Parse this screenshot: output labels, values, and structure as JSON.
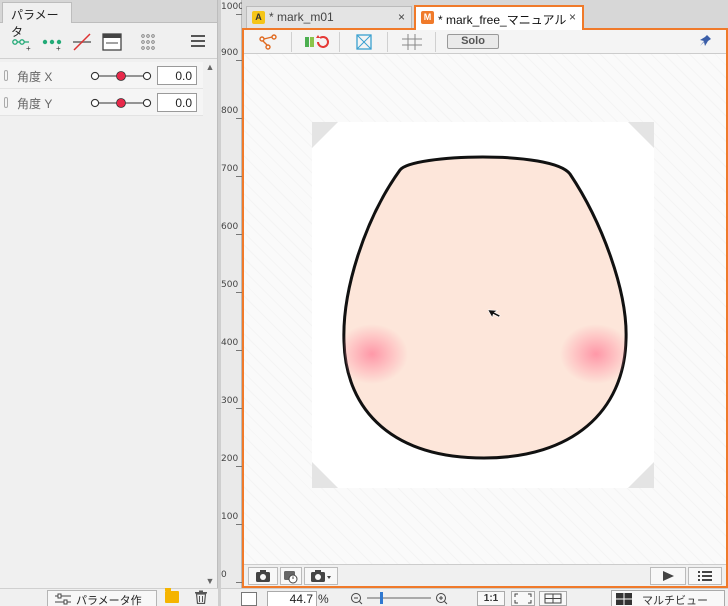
{
  "left_panel": {
    "tab_label": "パラメータ",
    "params": [
      {
        "name": "角度 X",
        "value": "0.0"
      },
      {
        "name": "角度 Y",
        "value": "0.0"
      }
    ],
    "create_button": "パラメータ作成"
  },
  "ruler": {
    "labels": [
      "1000",
      "900",
      "800",
      "700",
      "600",
      "500",
      "400",
      "300",
      "200",
      "100",
      "0"
    ]
  },
  "doc_tabs": [
    {
      "badge": "A",
      "label": "* mark_m01",
      "close": "×",
      "active": false
    },
    {
      "badge": "M",
      "label": "* mark_free_マニュアル",
      "close": "×",
      "active": true
    }
  ],
  "editor": {
    "solo_label": "Solo"
  },
  "status": {
    "zoom_value": "44.7",
    "zoom_unit": "%",
    "ratio_label": "1:1",
    "view_mode": "マルチビュー"
  },
  "colors": {
    "accent": "#f07a2a",
    "face_fill": "#fde6da",
    "blush": "#ff9aaa",
    "slider_knob": "#e8284a"
  }
}
